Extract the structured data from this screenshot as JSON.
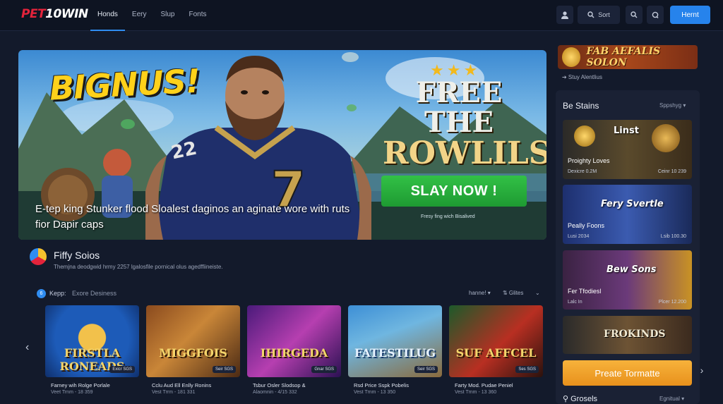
{
  "header": {
    "logo_red": "PET",
    "logo_white": "10WIN",
    "nav": [
      "Honds",
      "Eery",
      "Slup",
      "Fonts"
    ],
    "search_label": "Sort",
    "login_label": "Hernt"
  },
  "hero": {
    "title": "BIGNUS!",
    "right_title_1": "FREE THE",
    "right_title_2": "ROWLILS",
    "cta_label": "SLAY NOW !",
    "cta_sub": "Fresy fing wich Bisalived",
    "desc": "E-tep king Stunker flood Sloalest daginos an aginate wore with ruts fior Dapir caps",
    "jersey": "7",
    "shoulder": "22"
  },
  "section": {
    "title": "Fiffy Soios",
    "desc": "Themjna deodgwid hrmy 2257 lgalosfile pornical olus agedffiineiste.",
    "sub_badge": "6",
    "sub_label": "Kepp:",
    "sub_label2": "Exore Desiness",
    "right1": "hanne! ▾",
    "right2": "⇅ Glites"
  },
  "cards": [
    {
      "name": "FIRSTLA RONEADS",
      "tag": "Exicr SGS",
      "cap": "Farney wih Rolge Porlale",
      "sub": "Veet Trnm - 18 359"
    },
    {
      "name": "MIGGFOIS",
      "tag": "Seir SGS",
      "cap": "Cclu Aud Ell Enlly Ronins",
      "sub": "Vest Trrm - 181 331"
    },
    {
      "name": "IHIRGEDA",
      "tag": "Gnar SGS",
      "cap": "Tsbur Osler Slodsop &",
      "sub": "Alaomnin - 4/15 332"
    },
    {
      "name": "FATESTILUG",
      "tag": "Seir SGS",
      "cap": "Rsd Price Sspk Pobelis",
      "sub": "Vest Trnm - 13 350"
    },
    {
      "name": "SUF AFFCEL",
      "tag": "Ses SGS",
      "cap": "Farty Mod. Pudae Peniel",
      "sub": "Vest Trnm - 13 360"
    }
  ],
  "side": {
    "promo": "FAB AEFALIS SOLON",
    "promo_sub": "➔ Stuy Alentlius",
    "panel_title": "Be Stains",
    "panel_sort": "Sppshyg ▾",
    "slots": [
      {
        "title": "Linst",
        "name": "Proighty Loves",
        "m1": "Dexicre 0.2M",
        "m2": "Ceinr 10 239"
      },
      {
        "title": "Fery Svertle",
        "name": "Peally Foons",
        "m1": "Lusi 2034",
        "m2": "Lsib 100.30"
      },
      {
        "title": "Bew Sons",
        "name": "Fer Tfodiesl",
        "m1": "Lalc In",
        "m2": "Plcer 12.200"
      },
      {
        "title": "FROKINDS",
        "name": "",
        "m1": "",
        "m2": ""
      }
    ],
    "create_label": "Preate Tormatte",
    "foot_label": "Grosels",
    "foot_right": "Egnitual ▾"
  },
  "colors": {
    "accent": "#2683ec",
    "cta_green": "#2fbf44",
    "create_orange": "#f0a12a",
    "brand_red": "#e3233b"
  }
}
